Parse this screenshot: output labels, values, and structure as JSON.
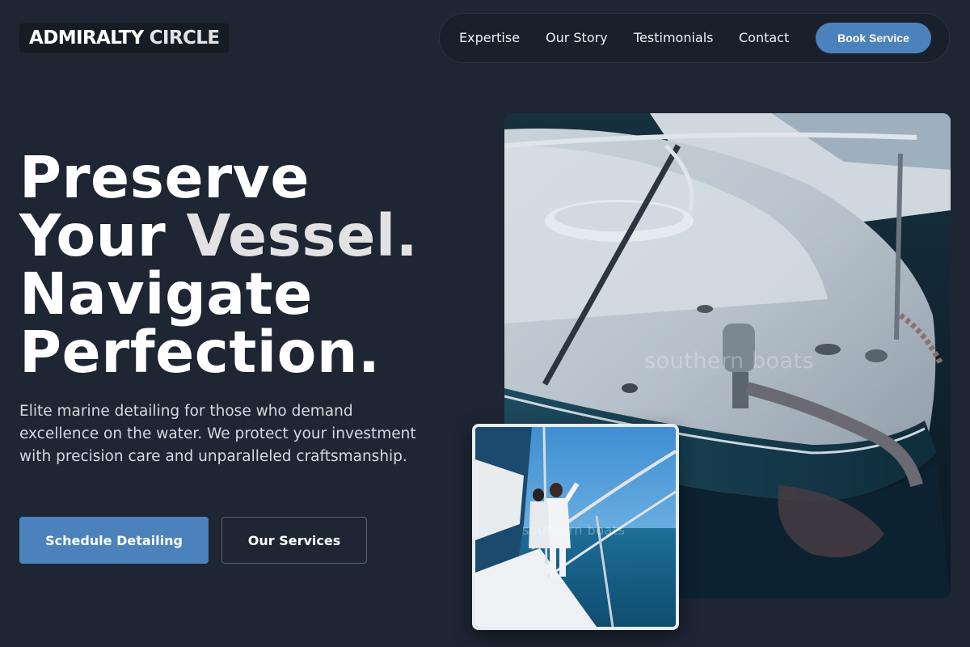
{
  "brand": {
    "name_part1": "ADMIRALTY",
    "name_part2": "CIRCLE"
  },
  "nav": {
    "items": [
      {
        "label": "Expertise"
      },
      {
        "label": "Our Story"
      },
      {
        "label": "Testimonials"
      },
      {
        "label": "Contact"
      }
    ],
    "cta_label": "Book Service"
  },
  "hero": {
    "headline": {
      "line1": "Preserve",
      "line2_a": "Your ",
      "line2_b": "Vessel.",
      "line3": "Navigate",
      "line4": "Perfection."
    },
    "subtitle": "Elite marine detailing for those who demand excellence on the water. We protect your investment with precision care and unparalleled craftsmanship.",
    "primary_cta": "Schedule Detailing",
    "secondary_cta": "Our Services"
  },
  "images": {
    "main_watermark": "southern boats",
    "inset_watermark": "southern boats"
  },
  "colors": {
    "background": "#1e2633",
    "accent": "#4b82bb",
    "nav_background": "#19202b"
  }
}
